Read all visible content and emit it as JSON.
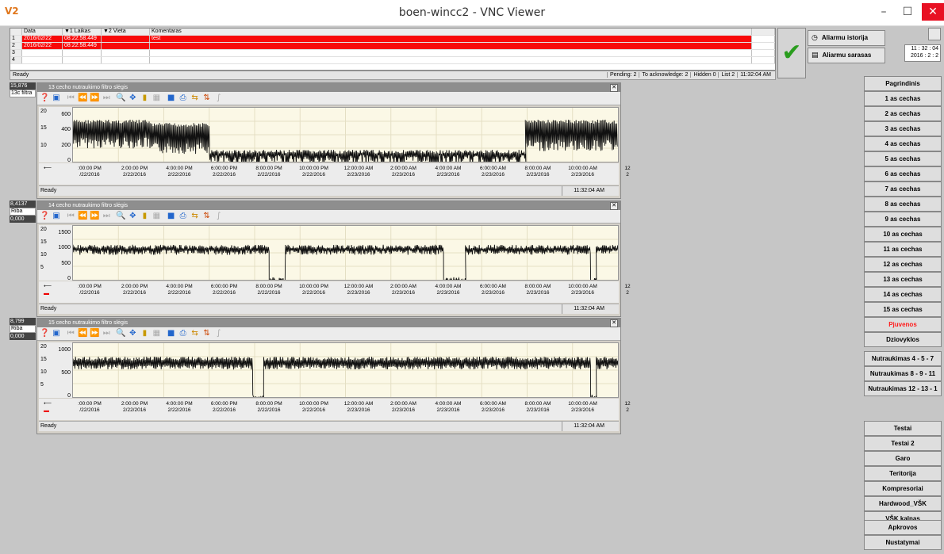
{
  "window": {
    "logo": "V2",
    "title": "boen-wincc2 - VNC Viewer",
    "min": "–",
    "max": "☐",
    "close": "✕"
  },
  "alarm": {
    "headers": [
      "",
      "Data",
      "▼1 Laikas",
      "▼2 Vieta",
      "Komentaras"
    ],
    "rows": [
      {
        "num": "1",
        "date": "2016/02/22",
        "time": "08:22:58.449",
        "place": "",
        "comment": "test"
      },
      {
        "num": "2",
        "date": "2016/02/22",
        "time": "08:22:58.449",
        "place": "",
        "comment": ""
      },
      {
        "num": "3",
        "date": "",
        "time": "",
        "place": "",
        "comment": ""
      },
      {
        "num": "4",
        "date": "",
        "time": "",
        "place": "",
        "comment": ""
      }
    ],
    "status_ready": "Ready",
    "pending": "Pending: 2",
    "to_ack": "To acknowledge: 2",
    "hidden": "Hidden 0",
    "list": "List 2",
    "time": "11:32:04 AM"
  },
  "header_buttons": {
    "history": "Aliarmu istorija",
    "list": "Aliarmu sarasas",
    "clock_line1": "11 : 32 : 04",
    "clock_line2": "2016 : 2 : 2"
  },
  "value_boxes": [
    {
      "value": "15,876",
      "label": "13c filtra",
      "zero": ""
    },
    {
      "value": "8,4137",
      "label": "Riba",
      "zero": "0,000"
    },
    {
      "value": "8,799",
      "label": "Riba",
      "zero": "0,000"
    }
  ],
  "trends": [
    {
      "title": "13 cecho nutraukimo filtro slėgis",
      "left_ticks": [
        "20",
        "15",
        "10"
      ],
      "right_ticks": [
        "600",
        "400",
        "200",
        "0"
      ],
      "status": "Ready",
      "time": "11:32:04 AM"
    },
    {
      "title": "14 cecho nutraukimo filtro slėgis",
      "left_ticks": [
        "20",
        "15",
        "10",
        "5"
      ],
      "right_ticks": [
        "1500",
        "1000",
        "500",
        "0"
      ],
      "status": "Ready",
      "time": "11:32:04 AM"
    },
    {
      "title": "15 cecho nutraukimo filtro slėgis",
      "left_ticks": [
        "20",
        "15",
        "10",
        "5"
      ],
      "right_ticks": [
        "1000",
        "500",
        "0"
      ],
      "status": "Ready",
      "time": "11:32:04 AM"
    }
  ],
  "x_ticks": [
    {
      "t": ":00:00 PM",
      "d": "/22/2016"
    },
    {
      "t": "2:00:00 PM",
      "d": "2/22/2016"
    },
    {
      "t": "4:00:00 PM",
      "d": "2/22/2016"
    },
    {
      "t": "6:00:00 PM",
      "d": "2/22/2016"
    },
    {
      "t": "8:00:00 PM",
      "d": "2/22/2016"
    },
    {
      "t": "10:00:00 PM",
      "d": "2/22/2016"
    },
    {
      "t": "12:00:00 AM",
      "d": "2/23/2016"
    },
    {
      "t": "2:00:00 AM",
      "d": "2/23/2016"
    },
    {
      "t": "4:00:00 AM",
      "d": "2/23/2016"
    },
    {
      "t": "6:00:00 AM",
      "d": "2/23/2016"
    },
    {
      "t": "8:00:00 AM",
      "d": "2/23/2016"
    },
    {
      "t": "10:00:00 AM",
      "d": "2/23/2016"
    },
    {
      "t": "12",
      "d": "2"
    }
  ],
  "nav": {
    "group1": [
      "Pagrindinis",
      "1 as cechas",
      "2 as cechas",
      "3 as cechas",
      "4 as cechas",
      "5 as cechas",
      "6 as cechas",
      "7 as cechas",
      "8 as cechas",
      "9 as cechas",
      "10 as cechas",
      "11 as cechas",
      "12 as cechas",
      "13 as cechas",
      "14 as cechas",
      "15 as cechas",
      "Pjuvenos",
      "Dziovyklos"
    ],
    "group2": [
      "Nutraukimas 4 - 5 - 7",
      "Nutraukimas 8 - 9 - 11",
      "Nutraukimas 12 - 13 - 1"
    ],
    "group3": [
      "Testai",
      "Testai 2",
      "Garo",
      "Teritorija",
      "Kompresoriai",
      "Hardwood_VŠK",
      "VŠK kalnas"
    ],
    "group4": [
      "Apkrovos",
      "Nustatymai"
    ]
  },
  "colors": {
    "alarm_red": "#f80808",
    "check_green": "#2a9d1e",
    "nav_alert": "#ff1a1a"
  }
}
